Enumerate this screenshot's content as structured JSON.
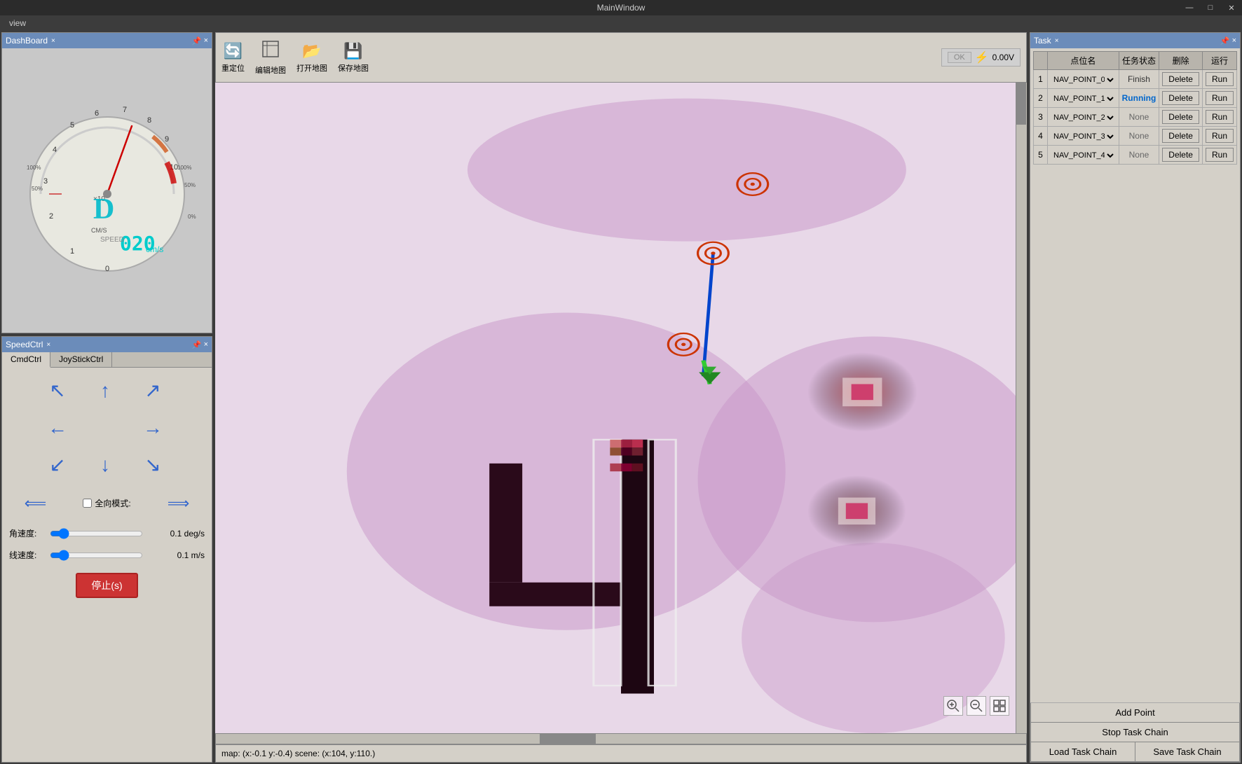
{
  "window": {
    "title": "MainWindow",
    "controls": {
      "minimize": "—",
      "maximize": "□",
      "close": "✕"
    }
  },
  "menubar": {
    "items": [
      "view"
    ]
  },
  "dashboard": {
    "title": "DashBoard",
    "close_btn": "×",
    "pin_btn": "📌",
    "speed_value": "020",
    "speed_unit": "cm/s",
    "speed_label": "SPEED",
    "direction_label": "D",
    "cm_s_label": "CM/S",
    "multiplier": "×10"
  },
  "speedctrl": {
    "title": "SpeedCtrl",
    "close_btn": "×",
    "pin_btn": "📌",
    "tabs": [
      "CmdCtrl",
      "JoyStickCtrl"
    ],
    "active_tab": "CmdCtrl",
    "omni_mode_label": "全向模式:",
    "angle_speed_label": "角速度:",
    "angle_speed_value": "0.1 deg/s",
    "line_speed_label": "线速度:",
    "line_speed_value": "0.1 m/s",
    "stop_btn_label": "停止(s)",
    "directions": {
      "upleft": "↖",
      "up": "↑",
      "upright": "↗",
      "left": "←",
      "right": "→",
      "downleft": "↙",
      "down": "↓",
      "downright": "↘",
      "leftbar": "◀◀",
      "rightbar": "▶▶"
    }
  },
  "toolbar": {
    "items": [
      {
        "label": "重定位",
        "icon": "🔄"
      },
      {
        "label": "编辑地图",
        "icon": "✏️"
      },
      {
        "label": "打开地图",
        "icon": "📂"
      },
      {
        "label": "保存地图",
        "icon": "💾"
      }
    ],
    "voltage_label": "0.00V",
    "voltage_icon": "⚡"
  },
  "map": {
    "status": "map: (x:-0.1 y:-0.4)  scene: (x:104, y:110.)"
  },
  "task": {
    "title": "Task",
    "close_btn": "×",
    "pin_btn": "📌",
    "columns": {
      "num": "",
      "name": "点位名",
      "status": "任务状态",
      "delete": "删除",
      "run": "运行"
    },
    "rows": [
      {
        "num": "1",
        "name": "NAV_POINT_0",
        "status": "Finish",
        "status_class": "status-finish",
        "delete": "Delete",
        "run": "Run"
      },
      {
        "num": "2",
        "name": "NAV_POINT_1",
        "status": "Running",
        "status_class": "status-running",
        "delete": "Delete",
        "run": "Run"
      },
      {
        "num": "3",
        "name": "NAV_POINT_2",
        "status": "None",
        "status_class": "status-none",
        "delete": "Delete",
        "run": "Run"
      },
      {
        "num": "4",
        "name": "NAV_POINT_3",
        "status": "None",
        "status_class": "status-none",
        "delete": "Delete",
        "run": "Run"
      },
      {
        "num": "5",
        "name": "NAV_POINT_4",
        "status": "None",
        "status_class": "status-none",
        "delete": "Delete",
        "run": "Run"
      }
    ],
    "add_point_btn": "Add Point",
    "stop_chain_btn": "Stop Task Chain",
    "load_chain_btn": "Load Task Chain",
    "save_chain_btn": "Save Task Chain"
  },
  "colors": {
    "panel_bg": "#d4d0c8",
    "title_bg": "#6b8cba",
    "accent_blue": "#3366cc",
    "red_btn": "#cc3333",
    "status_running": "#0066cc"
  }
}
